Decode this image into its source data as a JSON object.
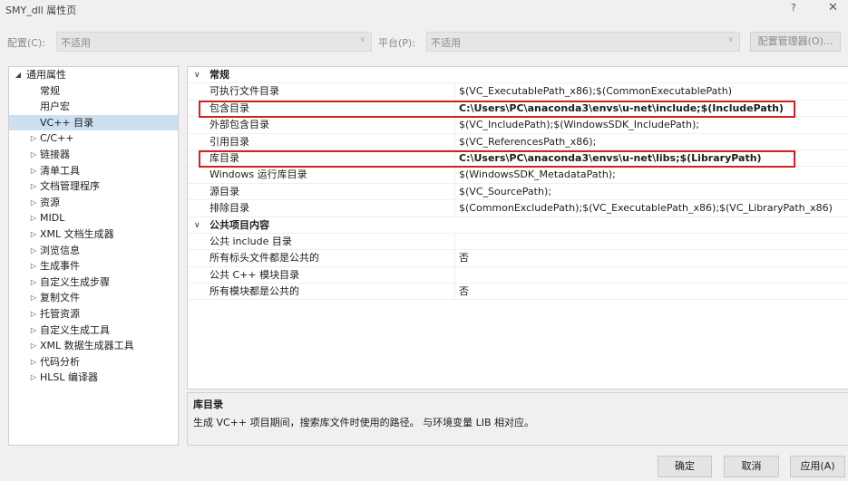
{
  "window": {
    "title": "SMY_dll 属性页",
    "help": "?",
    "close": "✕"
  },
  "config": {
    "config_label": "配置(C):",
    "config_value": "不适用",
    "platform_label": "平台(P):",
    "platform_value": "不适用",
    "manager_button": "配置管理器(O)..."
  },
  "tree": {
    "items": [
      {
        "label": "通用属性",
        "expander": "◢"
      },
      {
        "label": "常规"
      },
      {
        "label": "用户宏"
      },
      {
        "label": "VC++ 目录",
        "selected": true
      },
      {
        "label": "C/C++",
        "expander": "▷"
      },
      {
        "label": "链接器",
        "expander": "▷"
      },
      {
        "label": "清单工具",
        "expander": "▷"
      },
      {
        "label": "文档管理程序",
        "expander": "▷"
      },
      {
        "label": "资源",
        "expander": "▷"
      },
      {
        "label": "MIDL",
        "expander": "▷"
      },
      {
        "label": "XML 文档生成器",
        "expander": "▷"
      },
      {
        "label": "浏览信息",
        "expander": "▷"
      },
      {
        "label": "生成事件",
        "expander": "▷"
      },
      {
        "label": "自定义生成步骤",
        "expander": "▷"
      },
      {
        "label": "复制文件",
        "expander": "▷"
      },
      {
        "label": "托管资源",
        "expander": "▷"
      },
      {
        "label": "自定义生成工具",
        "expander": "▷"
      },
      {
        "label": "XML 数据生成器工具",
        "expander": "▷"
      },
      {
        "label": "代码分析",
        "expander": "▷"
      },
      {
        "label": "HLSL 编译器",
        "expander": "▷"
      }
    ]
  },
  "grid": {
    "cat1": {
      "caret": "∨",
      "label": "常规"
    },
    "general": [
      {
        "name": "可执行文件目录",
        "value": "$(VC_ExecutablePath_x86);$(CommonExecutablePath)"
      },
      {
        "name": "包含目录",
        "value": "C:\\Users\\PC\\anaconda3\\envs\\u-net\\include;$(IncludePath)",
        "bold": true
      },
      {
        "name": "外部包含目录",
        "value": "$(VC_IncludePath);$(WindowsSDK_IncludePath);"
      },
      {
        "name": "引用目录",
        "value": "$(VC_ReferencesPath_x86);"
      },
      {
        "name": "库目录",
        "value": "C:\\Users\\PC\\anaconda3\\envs\\u-net\\libs;$(LibraryPath)",
        "bold": true
      },
      {
        "name": "Windows 运行库目录",
        "value": "$(WindowsSDK_MetadataPath);"
      },
      {
        "name": "源目录",
        "value": "$(VC_SourcePath);"
      },
      {
        "name": "排除目录",
        "value": "$(CommonExcludePath);$(VC_ExecutablePath_x86);$(VC_LibraryPath_x86)"
      }
    ],
    "cat2": {
      "caret": "∨",
      "label": "公共项目内容"
    },
    "public": [
      {
        "name": "公共 include 目录",
        "value": ""
      },
      {
        "name": "所有标头文件都是公共的",
        "value": "否"
      },
      {
        "name": "公共 C++ 模块目录",
        "value": ""
      },
      {
        "name": "所有模块都是公共的",
        "value": "否"
      }
    ]
  },
  "description": {
    "title": "库目录",
    "text": "生成 VC++ 项目期间，搜索库文件时使用的路径。 与环境变量 LIB 相对应。"
  },
  "buttons": {
    "ok": "确定",
    "cancel": "取消",
    "apply": "应用(A)"
  },
  "colors": {
    "highlight_box": "#d32020",
    "selection": "#cde0f0"
  }
}
